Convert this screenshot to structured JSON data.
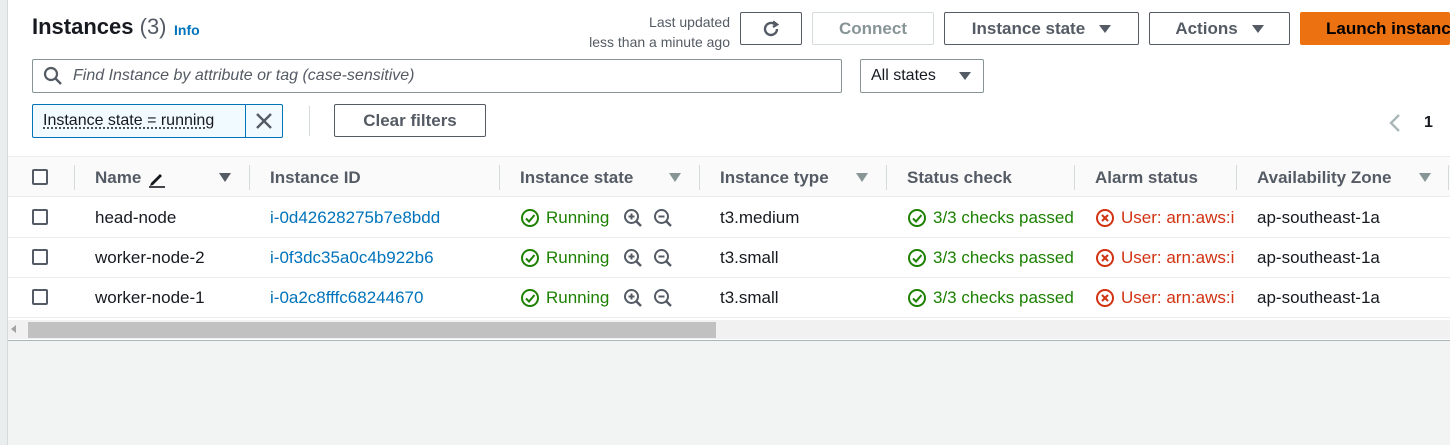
{
  "header": {
    "title": "Instances",
    "count": "(3)",
    "info": "Info",
    "updated_line1": "Last updated",
    "updated_line2": "less than a minute ago"
  },
  "toolbar": {
    "connect": "Connect",
    "instance_state": "Instance state",
    "actions": "Actions",
    "launch": "Launch instances"
  },
  "search": {
    "placeholder": "Find Instance by attribute or tag (case-sensitive)"
  },
  "state_filter": {
    "selected": "All states"
  },
  "filter_token": {
    "label": "Instance state = running"
  },
  "clear_filters": "Clear filters",
  "pagination": {
    "page": "1"
  },
  "columns": [
    "Name",
    "Instance ID",
    "Instance state",
    "Instance type",
    "Status check",
    "Alarm status",
    "Availability Zone"
  ],
  "rows": [
    {
      "name": "head-node",
      "id": "i-0d42628275b7e8bdd",
      "state": "Running",
      "type": "t3.medium",
      "status": "3/3 checks passed",
      "alarm": "User: arn:aws:iam",
      "az": "ap-southeast-1a"
    },
    {
      "name": "worker-node-2",
      "id": "i-0f3dc35a0c4b922b6",
      "state": "Running",
      "type": "t3.small",
      "status": "3/3 checks passed",
      "alarm": "User: arn:aws:iam",
      "az": "ap-southeast-1a"
    },
    {
      "name": "worker-node-1",
      "id": "i-0a2c8fffc68244670",
      "state": "Running",
      "type": "t3.small",
      "status": "3/3 checks passed",
      "alarm": "User: arn:aws:iam",
      "az": "ap-southeast-1a"
    }
  ],
  "colors": {
    "link": "#0073bb",
    "success": "#1d8102",
    "error": "#d13212",
    "primary": "#ec7211"
  }
}
